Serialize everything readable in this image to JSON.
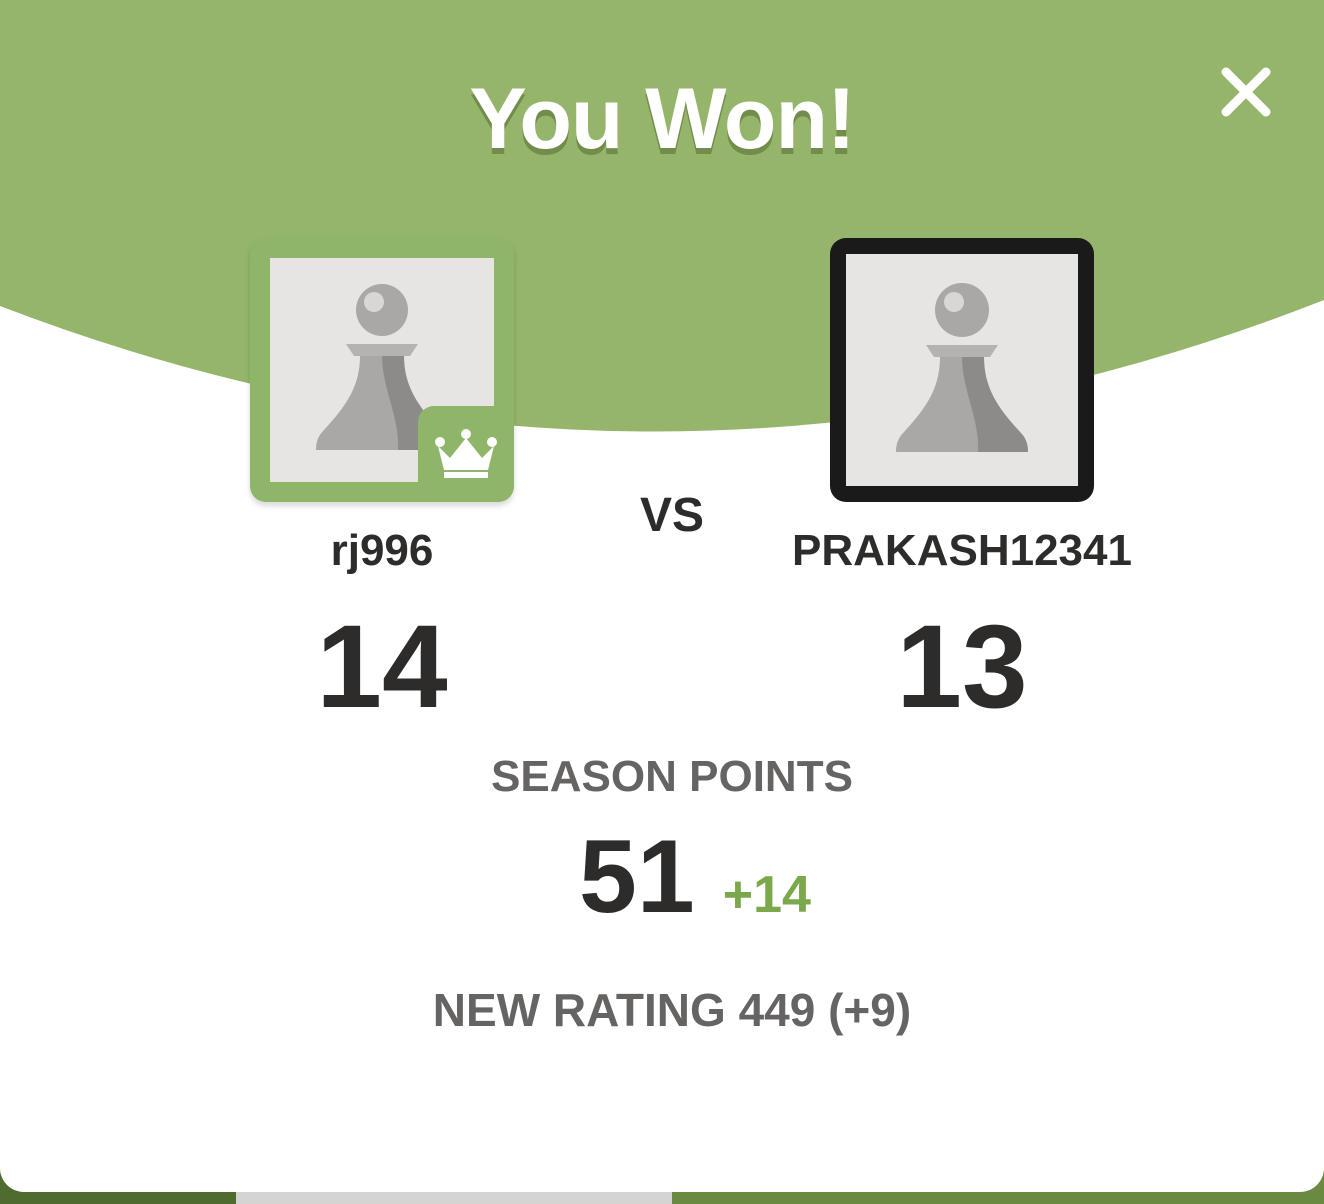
{
  "modal": {
    "title": "You Won!",
    "close_icon": "close-icon",
    "vs_label": "VS"
  },
  "players": [
    {
      "name": "rj996",
      "score": "14",
      "result": "winner",
      "badge_icon": "crown-icon",
      "avatar_icon": "pawn-icon"
    },
    {
      "name": "PRAKASH12341",
      "score": "13",
      "result": "loser",
      "avatar_icon": "pawn-icon"
    }
  ],
  "season": {
    "label": "SEASON POINTS",
    "value": "51",
    "delta": "+14"
  },
  "rating": {
    "text": "NEW RATING 449 (+9)"
  },
  "colors": {
    "header_green": "#95b56a",
    "accent_green": "#7aa84a",
    "dark_text": "#2d2c2a",
    "muted_text": "#666463"
  }
}
